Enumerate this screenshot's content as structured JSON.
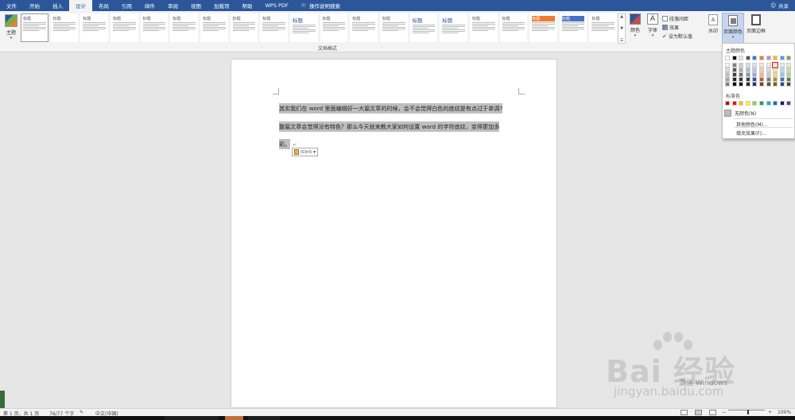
{
  "tabs": [
    "文件",
    "开始",
    "插入",
    "设计",
    "布局",
    "引用",
    "邮件",
    "审阅",
    "视图",
    "加载项",
    "帮助",
    "WPS PDF"
  ],
  "active_tab": "设计",
  "tell_me": "操作说明搜索",
  "share": "共享",
  "ribbon": {
    "theme_label": "主题",
    "style_group_label": "文档格式",
    "style_titles": [
      "标题",
      "标题",
      "标题",
      "标题",
      "标题",
      "标题",
      "标题",
      "标题",
      "标题",
      "标题",
      "标题",
      "标题",
      "标题",
      "标题",
      "标题",
      "标题",
      "标题",
      "标题",
      "标题",
      "标题"
    ],
    "colors_label": "颜色",
    "fonts_label": "字体",
    "paragraph_spacing": "段落间距",
    "effects": "效果",
    "set_default": "设为默认值",
    "watermark_label": "水印",
    "page_color_label": "页面颜色",
    "page_border_label": "页面边框"
  },
  "document": {
    "line1": "其实我们在 word 里面编辑好一大篇文章的时候，会不会觉得白色的底纹是有点过于单调?",
    "line2": "整篇文章会觉得没有特色？那么今天就来教大家如何设置 word 的字符底纹，变得更加多",
    "line3": "彩。",
    "paste_options": "(Ctrl)"
  },
  "page_color_menu": {
    "theme_colors_label": "主题颜色",
    "theme_columns": [
      [
        "#ffffff",
        "#f2f2f2",
        "#d9d9d9",
        "#bfbfbf",
        "#a6a6a6",
        "#808080"
      ],
      [
        "#000000",
        "#808080",
        "#595959",
        "#404040",
        "#262626",
        "#0d0d0d"
      ],
      [
        "#e7e6e6",
        "#d0cece",
        "#aeabab",
        "#757171",
        "#3a3838",
        "#171616"
      ],
      [
        "#44546a",
        "#d6dce4",
        "#adb9ca",
        "#8497b0",
        "#333f4f",
        "#222a35"
      ],
      [
        "#4472c4",
        "#d9e2f3",
        "#b4c6e7",
        "#8eaadb",
        "#2f5496",
        "#1f3864"
      ],
      [
        "#ed7d31",
        "#fbe5d6",
        "#f8cbad",
        "#f4b183",
        "#c55a11",
        "#843c0c"
      ],
      [
        "#a5a5a5",
        "#ededed",
        "#dbdbdb",
        "#c9c9c9",
        "#7b7b7b",
        "#525252"
      ],
      [
        "#ffc000",
        "#fff2cc",
        "#ffe699",
        "#ffd966",
        "#bf9000",
        "#7f6000"
      ],
      [
        "#5b9bd5",
        "#deebf7",
        "#bdd7ee",
        "#9dc3e6",
        "#2e75b6",
        "#1f4e79"
      ],
      [
        "#70ad47",
        "#e2f0d9",
        "#c5e0b4",
        "#a9d18e",
        "#538135",
        "#375623"
      ]
    ],
    "standard_colors_label": "标准色",
    "standard_colors": [
      "#c00000",
      "#ff0000",
      "#ffc000",
      "#ffff00",
      "#92d050",
      "#00b050",
      "#00b0f0",
      "#0070c0",
      "#002060",
      "#7030a0"
    ],
    "no_color": "无颜色(N)",
    "more_colors": "其他颜色(M)...",
    "fill_effects": "填充效果(F)..."
  },
  "status": {
    "page": "第 1 页，共 1 页",
    "words": "76/77 个字",
    "language": "中文(中国)",
    "zoom": "100%"
  },
  "watermarks": {
    "activate": "激活 Windows",
    "baidu": "Bai 经验",
    "jingyan": "jingyan.baidu.com"
  }
}
